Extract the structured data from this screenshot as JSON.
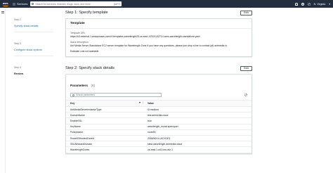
{
  "topbar": {
    "logo": "aws",
    "services_label": "Services",
    "search_placeholder": "Search for services, features, blogs, docs, and more",
    "search_shortcut": "[Alt+S]",
    "region": "N. Virginia",
    "account": "▾"
  },
  "steps": [
    {
      "number": "Step 2",
      "label": "Specify stack details"
    },
    {
      "number": "Step 3",
      "label": "Configure stack options"
    },
    {
      "number": "Step 4",
      "label": "Review"
    }
  ],
  "step1": {
    "title": "Step 1: Specify template",
    "edit_label": "Edit",
    "card_title": "Template",
    "template_url_label": "Template URL",
    "template_url": "https://s3-external-1.amazonaws.com/cf-templates-wavelength25-us-east-1/2021132714-wms-wavelength-standalone.yaml",
    "description_label": "Stack description",
    "description": "Ant Media Server Standalone EC2 server template for Wavelength Zone If you have any questions, please just drop a line to contact (at) antmedia.io",
    "estimate_cost": "Estimate cost not available"
  },
  "step2": {
    "title": "Step 2: Specify stack details",
    "edit_label": "Edit",
    "params_title": "Parameters",
    "params_count": "(8)",
    "filter_placeholder": "Search parameters",
    "col_key": "Key",
    "col_value": "Value",
    "rows": [
      {
        "key": "AntMediaServerInstanceType",
        "value": "t3.medium"
      },
      {
        "key": "DomainName",
        "value": "test.antmedia.cloud"
      },
      {
        "key": "EnableSSL",
        "value": "true"
      },
      {
        "key": "KeyName",
        "value": "wavelength_murat-specsport"
      },
      {
        "key": "PolicyName",
        "value": "route53"
      },
      {
        "key": "Route53HostedZoneId",
        "value": "Z08AN0XLLACXDE3"
      },
      {
        "key": "SSLWildcardDomain",
        "value": "stest.wavelength.antmedia.cloud"
      },
      {
        "key": "WavelengthZones",
        "value": "us-east-1-wl1-bos-wlz-1"
      }
    ]
  }
}
